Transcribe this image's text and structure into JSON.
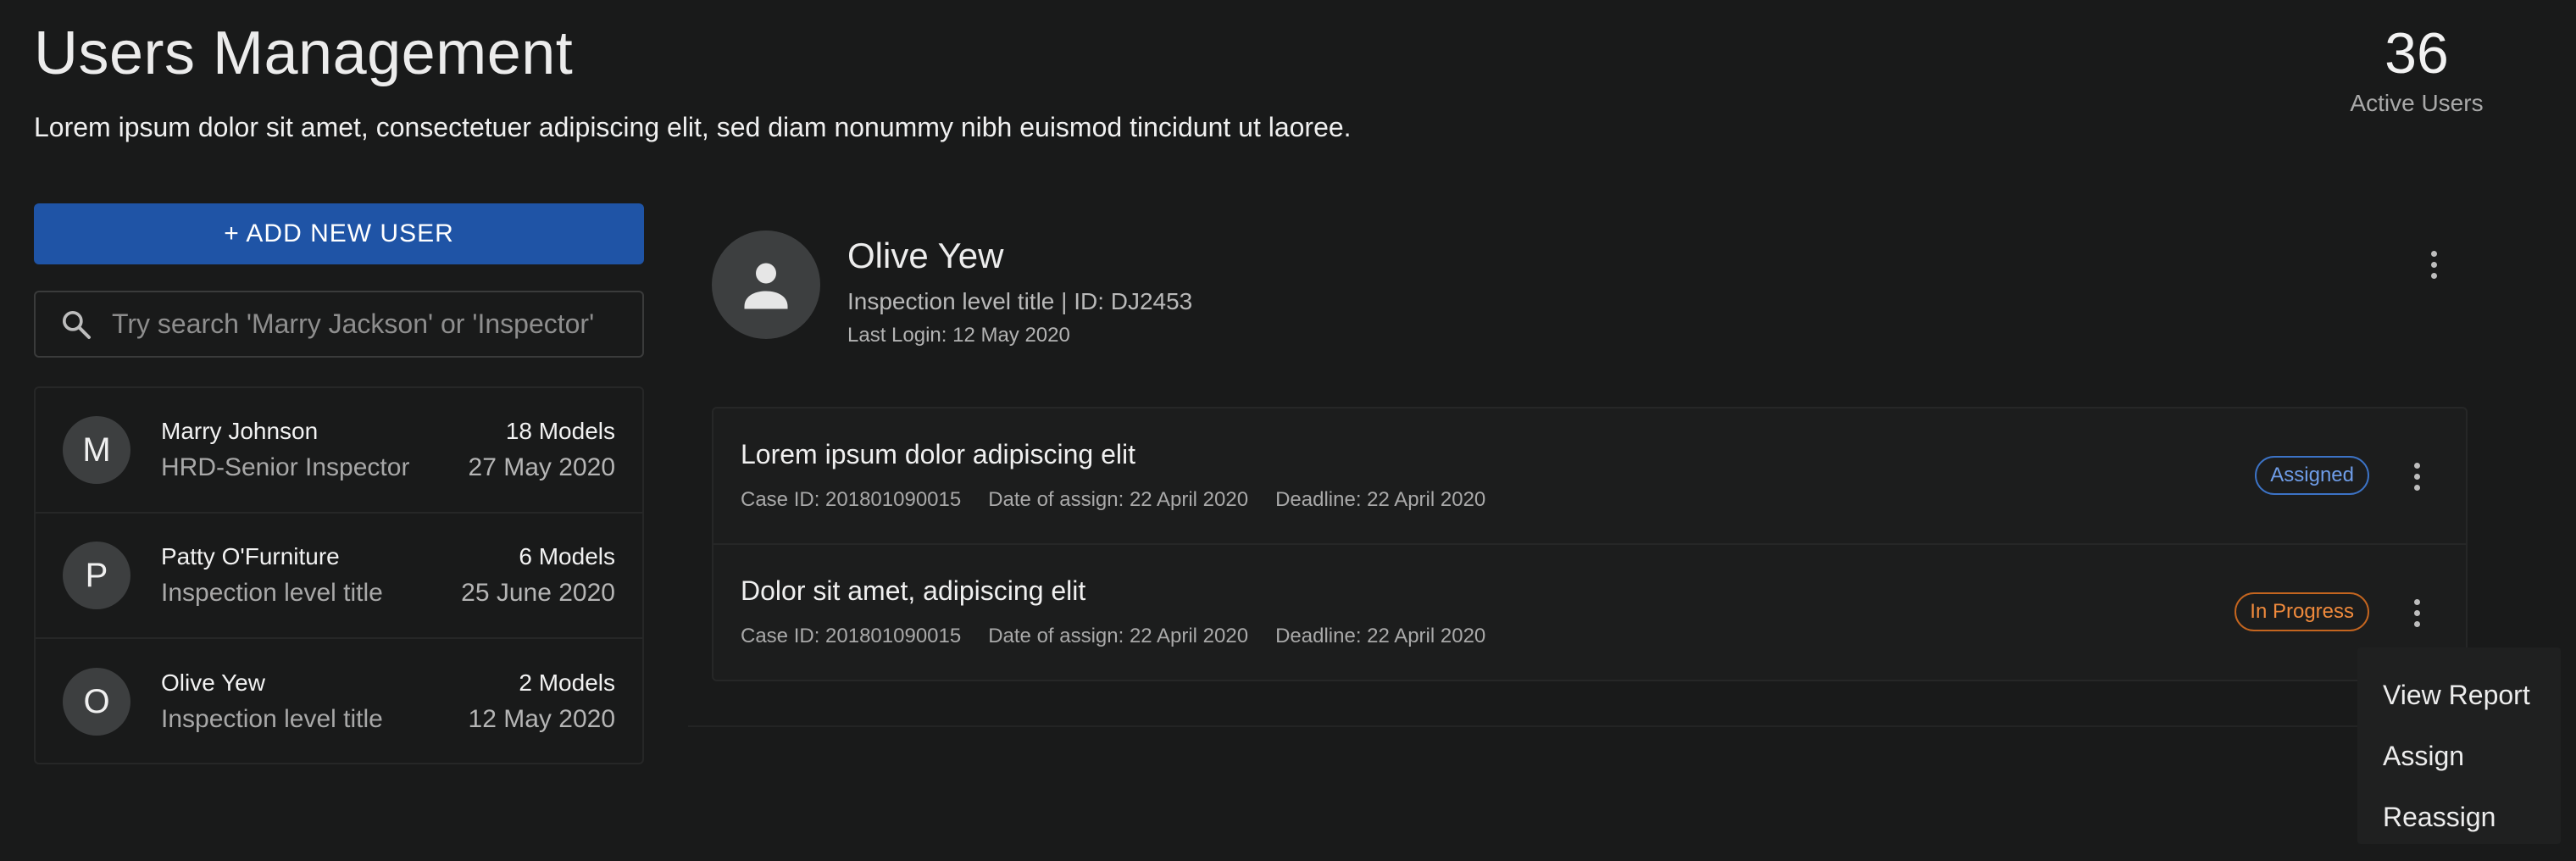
{
  "header": {
    "title": "Users Management",
    "subtitle": "Lorem ipsum dolor sit amet, consectetuer adipiscing elit, sed diam nonummy nibh euismod tincidunt ut laoree.",
    "stat_value": "36",
    "stat_label": "Active Users"
  },
  "sidebar": {
    "add_button_label": "+ ADD NEW USER",
    "search_placeholder": "Try search 'Marry Jackson' or 'Inspector'",
    "search_value": "",
    "users": [
      {
        "initial": "M",
        "name": "Marry Johnson",
        "role": "HRD-Senior Inspector",
        "models": "18 Models",
        "date": "27 May 2020"
      },
      {
        "initial": "P",
        "name": "Patty O'Furniture",
        "role": "Inspection level title",
        "models": "6 Models",
        "date": "25 June 2020"
      },
      {
        "initial": "O",
        "name": "Olive Yew",
        "role": "Inspection level title",
        "models": "2 Models",
        "date": "12 May 2020"
      }
    ]
  },
  "profile": {
    "name": "Olive Yew",
    "title": "Inspection level title | ID: DJ2453",
    "last_login": "Last Login: 12 May 2020",
    "avatar_icon": "person-icon",
    "menu_icon": "more-vertical-icon"
  },
  "cases": [
    {
      "title": "Lorem ipsum dolor adipiscing elit",
      "case_id": "Case ID: 201801090015",
      "date_assign": "Date of assign: 22 April 2020",
      "deadline": "Deadline: 22 April 2020",
      "status": "Assigned"
    },
    {
      "title": "Dolor sit amet, adipiscing elit",
      "case_id": "Case ID: 201801090015",
      "date_assign": "Date of assign: 22 April 2020",
      "deadline": "Deadline: 22 April 2020",
      "status": "In Progress"
    }
  ],
  "context_menu": {
    "items": [
      "View Report",
      "Assign",
      "Reassign"
    ]
  },
  "colors": {
    "background": "#191a1a",
    "primary_button": "#1f54a6",
    "assigned_badge": "#6f9de8",
    "in_progress_badge": "#f08a3c"
  }
}
